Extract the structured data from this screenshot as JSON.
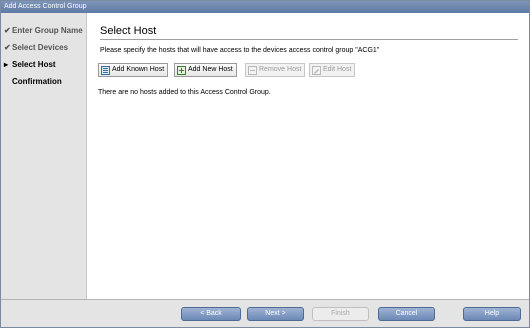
{
  "window": {
    "title": "Add Access Control Group"
  },
  "steps": [
    {
      "mark": "✔",
      "label": "Enter Group Name"
    },
    {
      "mark": "✔",
      "label": "Select Devices"
    },
    {
      "mark": "▸",
      "label": "Select Host"
    },
    {
      "mark": "",
      "label": "Confirmation"
    }
  ],
  "page": {
    "title": "Select Host",
    "instruction": "Please specify the hosts that will have access to the devices access control group  \"ACG1\"",
    "empty_message": "There are no hosts added to this Access Control Group."
  },
  "toolbar": {
    "add_known": "Add Known Host",
    "add_new": "Add New Host",
    "remove": "Remove Host",
    "edit": "Edit Host"
  },
  "footer": {
    "back": "< Back",
    "next": "Next >",
    "finish": "Finish",
    "cancel": "Cancel",
    "help": "Help"
  }
}
